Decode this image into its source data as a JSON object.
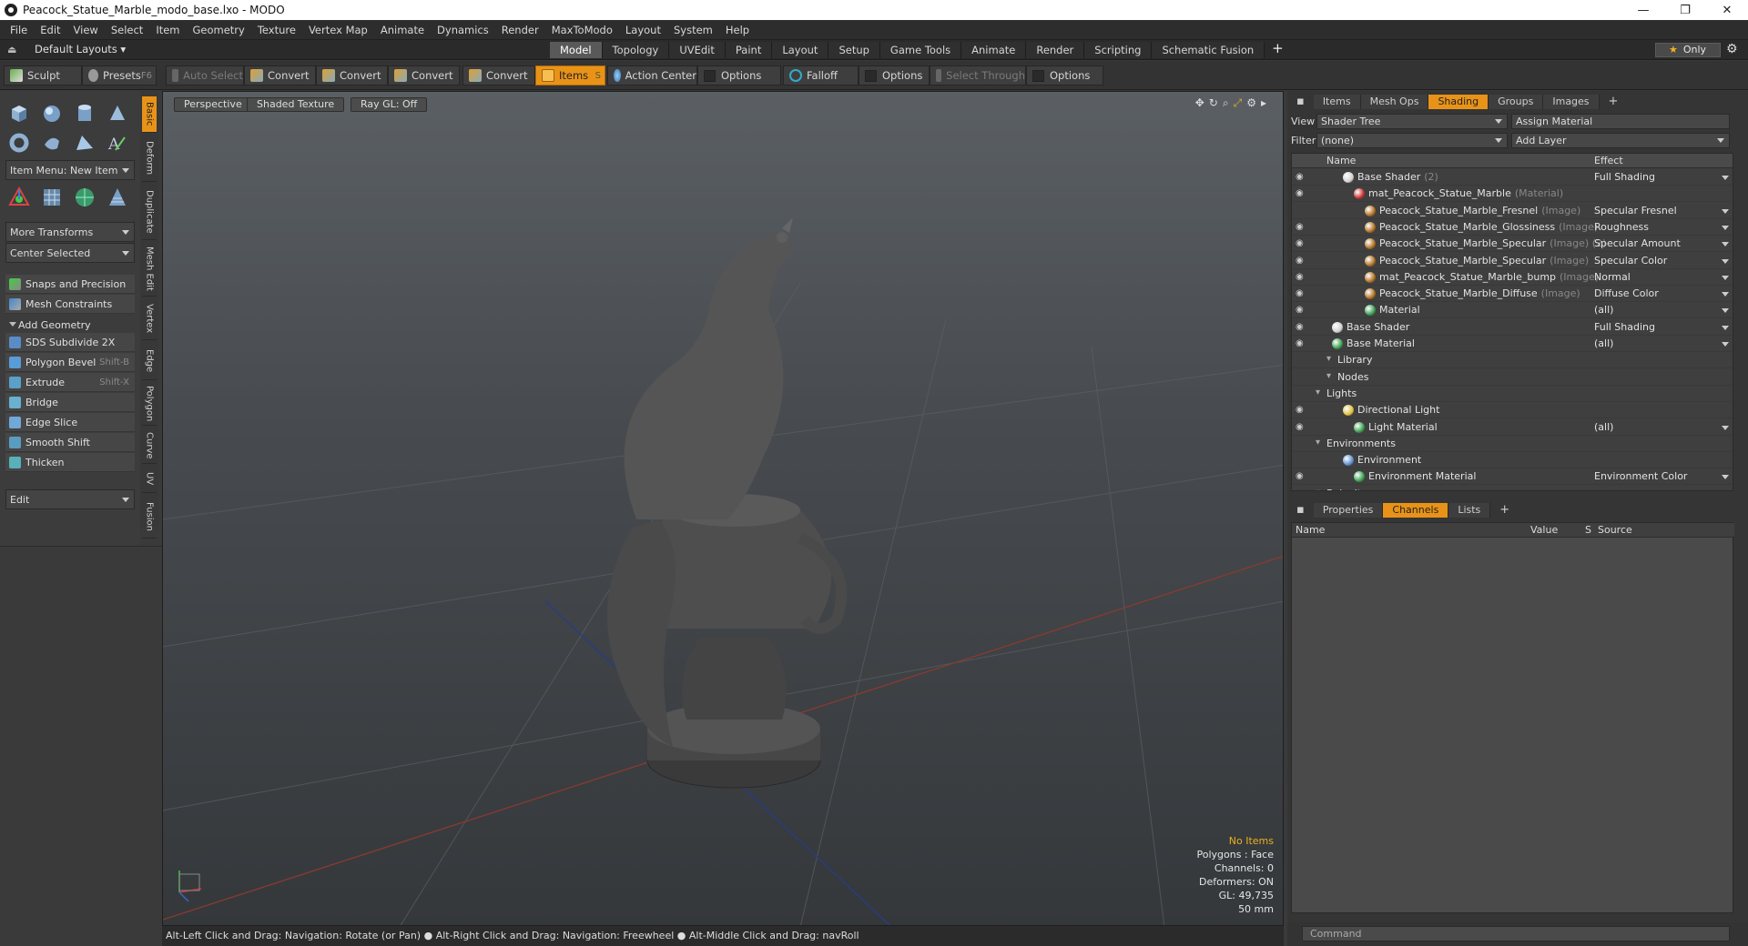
{
  "window": {
    "title": "Peacock_Statue_Marble_modo_base.lxo - MODO",
    "minimize": "—",
    "maximize": "❐",
    "close": "✕"
  },
  "menu": [
    "File",
    "Edit",
    "View",
    "Select",
    "Item",
    "Geometry",
    "Texture",
    "Vertex Map",
    "Animate",
    "Dynamics",
    "Render",
    "MaxToModo",
    "Layout",
    "System",
    "Help"
  ],
  "layout": {
    "default": "Default Layouts ▾",
    "tabs": [
      "Model",
      "Topology",
      "UVEdit",
      "Paint",
      "Layout",
      "Setup",
      "Game Tools",
      "Animate",
      "Render",
      "Scripting",
      "Schematic Fusion"
    ],
    "active_tab": "Model",
    "plus": "+",
    "only": "Only",
    "star": "★"
  },
  "toolbar": {
    "sculpt": "Sculpt",
    "presets": "Presets",
    "presets_key": "F6",
    "auto_select": "Auto Select",
    "convert": "Convert",
    "items": "Items",
    "items_key": "S",
    "action_center": "Action Center",
    "options": "Options",
    "falloff": "Falloff",
    "select_through": "Select Through"
  },
  "left": {
    "item_menu": "Item Menu: New Item",
    "more_transforms": "More Transforms",
    "center_selected": "Center Selected",
    "snaps": "Snaps and Precision",
    "mesh_constraints": "Mesh Constraints",
    "add_geometry": "Add Geometry",
    "tools": [
      {
        "label": "SDS Subdivide 2X",
        "key": ""
      },
      {
        "label": "Polygon Bevel",
        "key": "Shift-B"
      },
      {
        "label": "Extrude",
        "key": "Shift-X"
      },
      {
        "label": "Bridge",
        "key": ""
      },
      {
        "label": "Edge Slice",
        "key": ""
      },
      {
        "label": "Smooth Shift",
        "key": ""
      },
      {
        "label": "Thicken",
        "key": ""
      }
    ],
    "edit": "Edit",
    "vtabs": [
      "Basic",
      "Deform",
      "Duplicate",
      "Mesh Edit",
      "Vertex",
      "Edge",
      "Polygon",
      "Curve",
      "UV",
      "Fusion"
    ]
  },
  "viewport": {
    "perspective": "Perspective",
    "shading": "Shaded Texture",
    "raygl": "Ray GL: Off",
    "hud": {
      "items": "No Items",
      "polygons": "Polygons : Face",
      "channels": "Channels: 0",
      "deformers": "Deformers: ON",
      "gl": "GL: 49,735",
      "mm": "50 mm"
    }
  },
  "status": "Alt-Left Click and Drag: Navigation: Rotate (or Pan) ● Alt-Right Click and Drag: Navigation: Freewheel ● Alt-Middle Click and Drag: navRoll",
  "right": {
    "tabs": [
      "Items",
      "Mesh Ops",
      "Shading",
      "Groups",
      "Images"
    ],
    "active_tab": "Shading",
    "view_label": "View",
    "view_value": "Shader Tree",
    "assign_material": "Assign Material",
    "filter_label": "Filter",
    "filter_value": "(none)",
    "add_layer": "Add Layer",
    "col_name": "Name",
    "col_effect": "Effect",
    "tree": [
      {
        "name": "Base Shader",
        "suffix": "(2)",
        "effect": "Full Shading",
        "indent": 58,
        "color": "#d0d0d0",
        "eye": true
      },
      {
        "name": "mat_Peacock_Statue_Marble",
        "suffix": "(Material)",
        "effect": "",
        "indent": 70,
        "color": "#c83030",
        "eye": true
      },
      {
        "name": "Peacock_Statue_Marble_Fresnel",
        "suffix": "(Image)",
        "effect": "Specular Fresnel",
        "indent": 82,
        "color": "#b07020",
        "eye": false
      },
      {
        "name": "Peacock_Statue_Marble_Glossiness",
        "suffix": "(Image)",
        "effect": "Roughness",
        "indent": 82,
        "color": "#b07020",
        "eye": true
      },
      {
        "name": "Peacock_Statue_Marble_Specular",
        "suffix": "(Image) (2)",
        "effect": "Specular Amount",
        "indent": 82,
        "color": "#b07020",
        "eye": true
      },
      {
        "name": "Peacock_Statue_Marble_Specular",
        "suffix": "(Image)",
        "effect": "Specular Color",
        "indent": 82,
        "color": "#b07020",
        "eye": true
      },
      {
        "name": "mat_Peacock_Statue_Marble_bump",
        "suffix": "(Image)",
        "effect": "Normal",
        "indent": 82,
        "color": "#b07020",
        "eye": true
      },
      {
        "name": "Peacock_Statue_Marble_Diffuse",
        "suffix": "(Image)",
        "effect": "Diffuse Color",
        "indent": 82,
        "color": "#b07020",
        "eye": true
      },
      {
        "name": "Material",
        "suffix": "",
        "effect": "(all)",
        "indent": 82,
        "color": "#3aa050",
        "eye": true
      },
      {
        "name": "Base Shader",
        "suffix": "",
        "effect": "Full Shading",
        "indent": 46,
        "color": "#d0d0d0",
        "eye": true
      },
      {
        "name": "Base Material",
        "suffix": "",
        "effect": "(all)",
        "indent": 46,
        "color": "#3aa050",
        "eye": true
      },
      {
        "name": "Library",
        "suffix": "",
        "effect": "",
        "indent": 50,
        "color": "",
        "eye": false
      },
      {
        "name": "Nodes",
        "suffix": "",
        "effect": "",
        "indent": 50,
        "color": "",
        "eye": false
      },
      {
        "name": "Lights",
        "suffix": "",
        "effect": "",
        "indent": 38,
        "color": "",
        "eye": false
      },
      {
        "name": "Directional Light",
        "suffix": "",
        "effect": "",
        "indent": 58,
        "color": "#e0c040",
        "eye": true
      },
      {
        "name": "Light Material",
        "suffix": "",
        "effect": "(all)",
        "indent": 70,
        "color": "#3aa050",
        "eye": true
      },
      {
        "name": "Environments",
        "suffix": "",
        "effect": "",
        "indent": 38,
        "color": "",
        "eye": false
      },
      {
        "name": "Environment",
        "suffix": "",
        "effect": "",
        "indent": 58,
        "color": "#6090d0",
        "eye": false
      },
      {
        "name": "Environment Material",
        "suffix": "",
        "effect": "Environment Color",
        "indent": 70,
        "color": "#3aa050",
        "eye": true
      },
      {
        "name": "Bake Items",
        "suffix": "",
        "effect": "",
        "indent": 38,
        "color": "",
        "eye": false
      }
    ],
    "lower_tabs": [
      "Properties",
      "Channels",
      "Lists"
    ],
    "lower_active": "Channels",
    "ch_cols": [
      "Name",
      "Value",
      "S",
      "Source"
    ],
    "command": "Command"
  }
}
